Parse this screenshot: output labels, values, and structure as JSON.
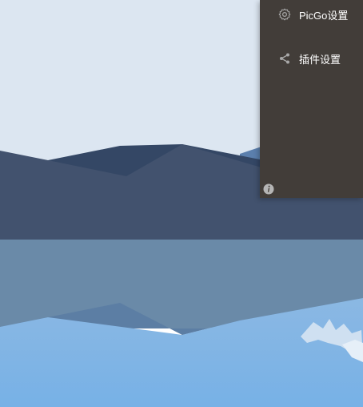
{
  "sidebar": {
    "items": [
      {
        "label": "PicGo设置",
        "icon": "gear-icon"
      },
      {
        "label": "插件设置",
        "icon": "share-icon"
      }
    ],
    "footer_icon": "info-icon"
  },
  "colors": {
    "menu_background": "#423d39",
    "menu_text": "#ffffff",
    "icon": "#a8a8a8",
    "sky": "#dce6f1",
    "mountain": "#42526e",
    "water": "#6b8aa8"
  }
}
